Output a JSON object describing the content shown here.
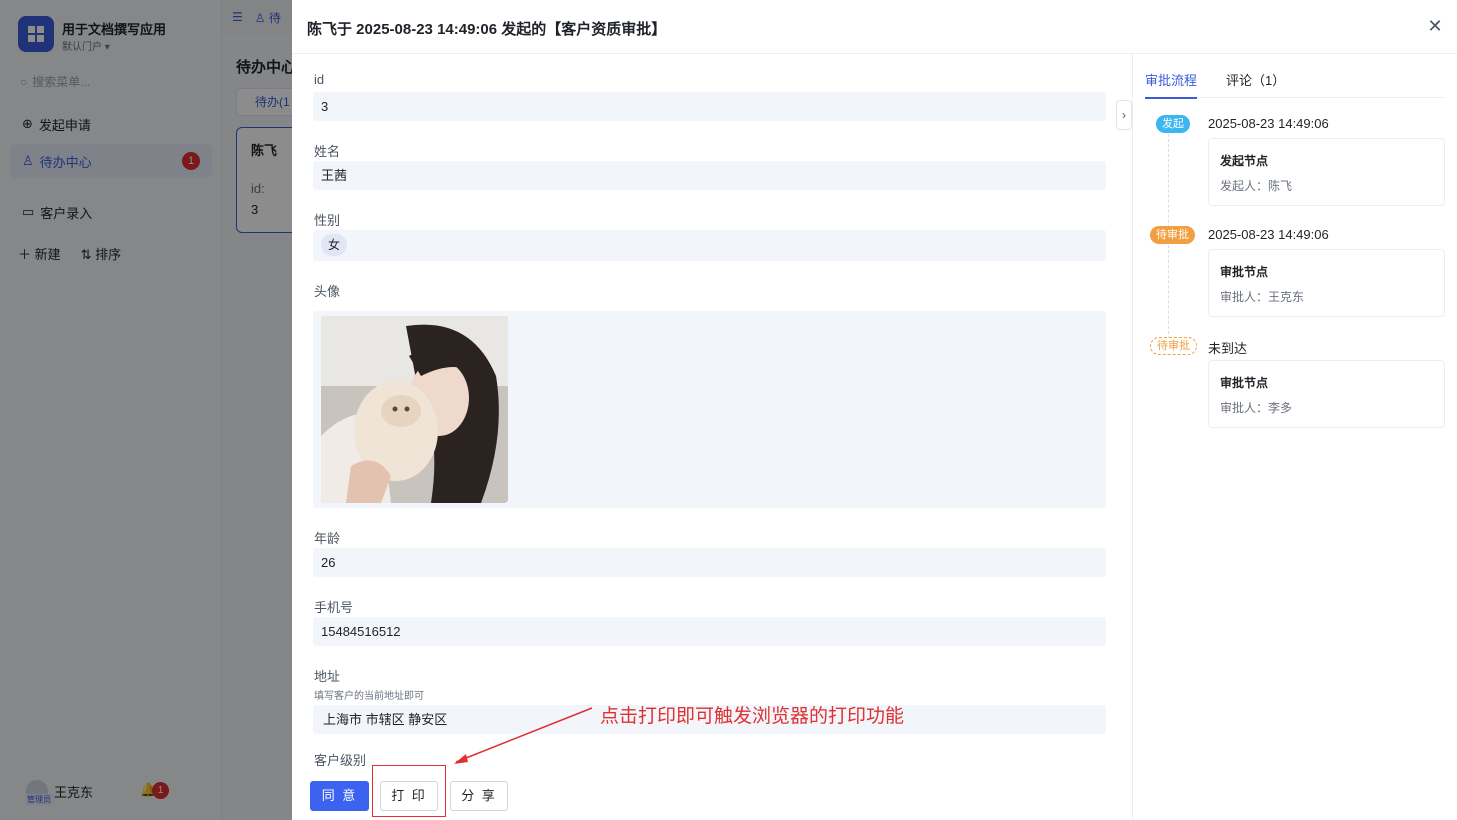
{
  "background": {
    "app_name": "用于文档撰写应用",
    "portal": "默认门户",
    "search_placeholder": "搜索菜单...",
    "menu": [
      {
        "label": "发起申请"
      },
      {
        "label": "待办中心",
        "badge": "1"
      },
      {
        "label": "客户录入"
      }
    ],
    "actions": {
      "new": "新建",
      "sort": "排序"
    },
    "user": {
      "name": "王克东",
      "role_tag": "管理员",
      "notif_count": "1"
    },
    "tab_label": "待",
    "page_title": "待办中心",
    "sub_tab": "待办(1",
    "card": {
      "name": "陈飞",
      "label": "id:",
      "value": "3"
    }
  },
  "drawer": {
    "title": "陈飞于 2025-08-23 14:49:06 发起的【客户资质审批】",
    "fields": {
      "id": {
        "label": "id",
        "value": "3"
      },
      "name": {
        "label": "姓名",
        "value": "王茜"
      },
      "gender": {
        "label": "性别",
        "value": "女"
      },
      "avatar": {
        "label": "头像"
      },
      "age": {
        "label": "年龄",
        "value": "26"
      },
      "phone": {
        "label": "手机号",
        "value": "15484516512"
      },
      "address": {
        "label": "地址",
        "hint": "填写客户的当前地址即可",
        "value": "上海市 市辖区 静安区"
      },
      "level": {
        "label": "客户级别"
      }
    },
    "buttons": {
      "agree": "同 意",
      "print": "打 印",
      "share": "分 享"
    },
    "annotation": "点击打印即可触发浏览器的打印功能"
  },
  "right_panel": {
    "tabs": [
      {
        "label": "审批流程"
      },
      {
        "label": "评论（1）"
      }
    ],
    "timeline": [
      {
        "tag": "发起",
        "tag_color": "#3bb6f0",
        "time": "2025-08-23 14:49:06",
        "node": "发起节点",
        "person": "发起人：陈飞"
      },
      {
        "tag": "待审批",
        "tag_color": "#f0a040",
        "time": "2025-08-23 14:49:06",
        "node": "审批节点",
        "person": "审批人：王克东"
      },
      {
        "tag": "待审批",
        "tag_color": "#f0a040",
        "time": "未到达",
        "node": "审批节点",
        "person": "审批人：李多"
      }
    ]
  }
}
